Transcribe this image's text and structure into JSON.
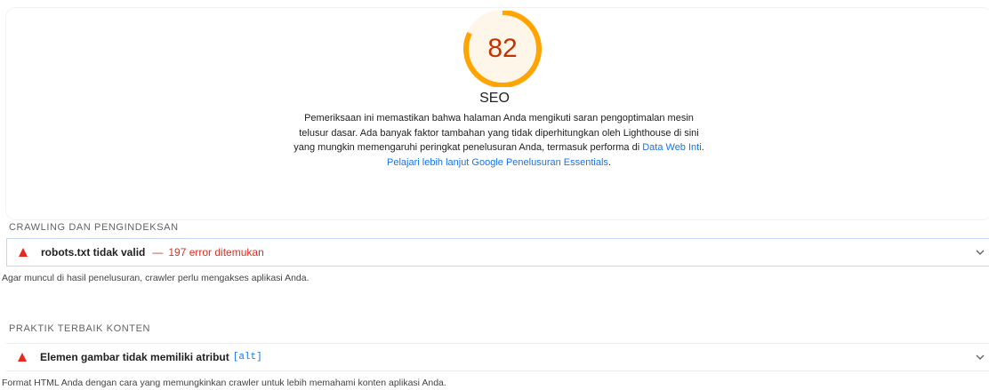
{
  "category": {
    "score": "82",
    "score_fraction": 0.82,
    "title": "SEO",
    "description": "Pemeriksaan ini memastikan bahwa halaman Anda mengikuti saran pengoptimalan mesin telusur dasar. Ada banyak faktor tambahan yang tidak diperhitungkan oleh Lighthouse di sini yang mungkin memengaruhi peringkat penelusuran Anda, termasuk performa di",
    "link_core_web_vitals": "Data Web Inti",
    "link_separator": ".",
    "link_learn_more": "Pelajari lebih lanjut Google Penelusuran Essentials",
    "link_end": "."
  },
  "colors": {
    "score_average": "#ffa400",
    "score_text": "#c33300",
    "fail_icon": "#e8271d",
    "link": "#1a73e8",
    "error_text": "#d93025"
  },
  "sections": [
    {
      "header": "CRAWLING DAN PENGINDEKSAN",
      "audit": {
        "title": "robots.txt tidak valid",
        "separator": "—",
        "display_value": "197 error ditemukan",
        "code": "",
        "icon": "fail-triangle-icon",
        "description": "Agar muncul di hasil penelusuran, crawler perlu mengakses aplikasi Anda."
      }
    },
    {
      "header": "PRAKTIK TERBAIK KONTEN",
      "audit": {
        "title": "Elemen gambar tidak memiliki atribut",
        "separator": "",
        "display_value": "",
        "code": "[alt]",
        "icon": "fail-triangle-icon",
        "description": "Format HTML Anda dengan cara yang memungkinkan crawler untuk lebih memahami konten aplikasi Anda."
      }
    }
  ]
}
